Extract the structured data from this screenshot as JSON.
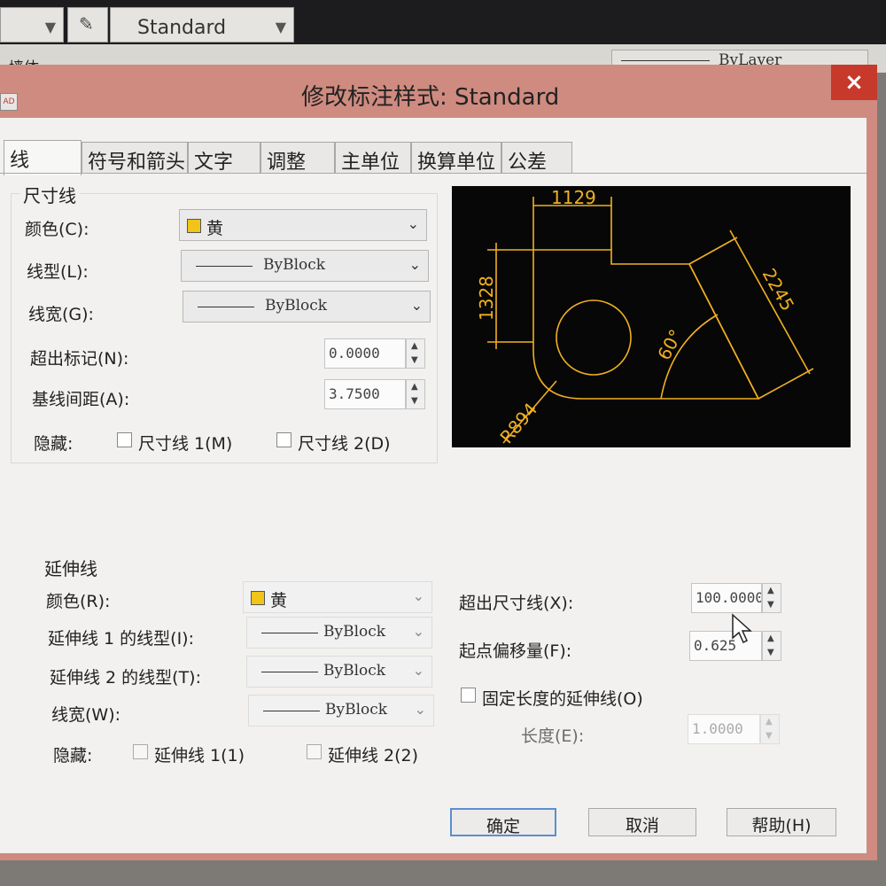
{
  "toolbar": {
    "style_value": "Standard",
    "layer_name": "墙体",
    "lineweight_value": "ByLayer"
  },
  "dialog": {
    "title": "修改标注样式: Standard",
    "close_glyph": "×"
  },
  "tabs": [
    {
      "label": "线",
      "active": true
    },
    {
      "label": "符号和箭头"
    },
    {
      "label": "文字"
    },
    {
      "label": "调整"
    },
    {
      "label": "主单位"
    },
    {
      "label": "换算单位"
    },
    {
      "label": "公差"
    }
  ],
  "dim_lines": {
    "title": "尺寸线",
    "color_label": "颜色(C):",
    "color_value": "黄",
    "color_hex": "#f0c419",
    "linetype_label": "线型(L):",
    "linetype_value": "ByBlock",
    "lineweight_label": "线宽(G):",
    "lineweight_value": "ByBlock",
    "extend_ticks_label": "超出标记(N):",
    "extend_ticks_value": "0.0000",
    "baseline_spacing_label": "基线间距(A):",
    "baseline_spacing_value": "3.7500",
    "suppress_label": "隐藏:",
    "suppress_1_label": "尺寸线 1(M)",
    "suppress_2_label": "尺寸线 2(D)"
  },
  "preview": {
    "dim_top": "1129",
    "dim_left": "1328",
    "dim_right": "2245",
    "dim_angle": "60°",
    "dim_radius": "R894"
  },
  "ext_lines": {
    "title": "延伸线",
    "color_label": "颜色(R):",
    "color_value": "黄",
    "linetype1_label": "延伸线 1 的线型(I):",
    "linetype1_value": "ByBlock",
    "linetype2_label": "延伸线 2 的线型(T):",
    "linetype2_value": "ByBlock",
    "lineweight_label": "线宽(W):",
    "lineweight_value": "ByBlock",
    "suppress_label": "隐藏:",
    "suppress_1_label": "延伸线 1(1)",
    "suppress_2_label": "延伸线 2(2)",
    "extend_beyond_label": "超出尺寸线(X):",
    "extend_beyond_value": "100.0000",
    "offset_label": "起点偏移量(F):",
    "offset_value": "0.625",
    "fixed_length_label": "固定长度的延伸线(O)",
    "length_label": "长度(E):",
    "length_value": "1.0000"
  },
  "buttons": {
    "ok": "确定",
    "cancel": "取消",
    "help": "帮助(H)"
  }
}
